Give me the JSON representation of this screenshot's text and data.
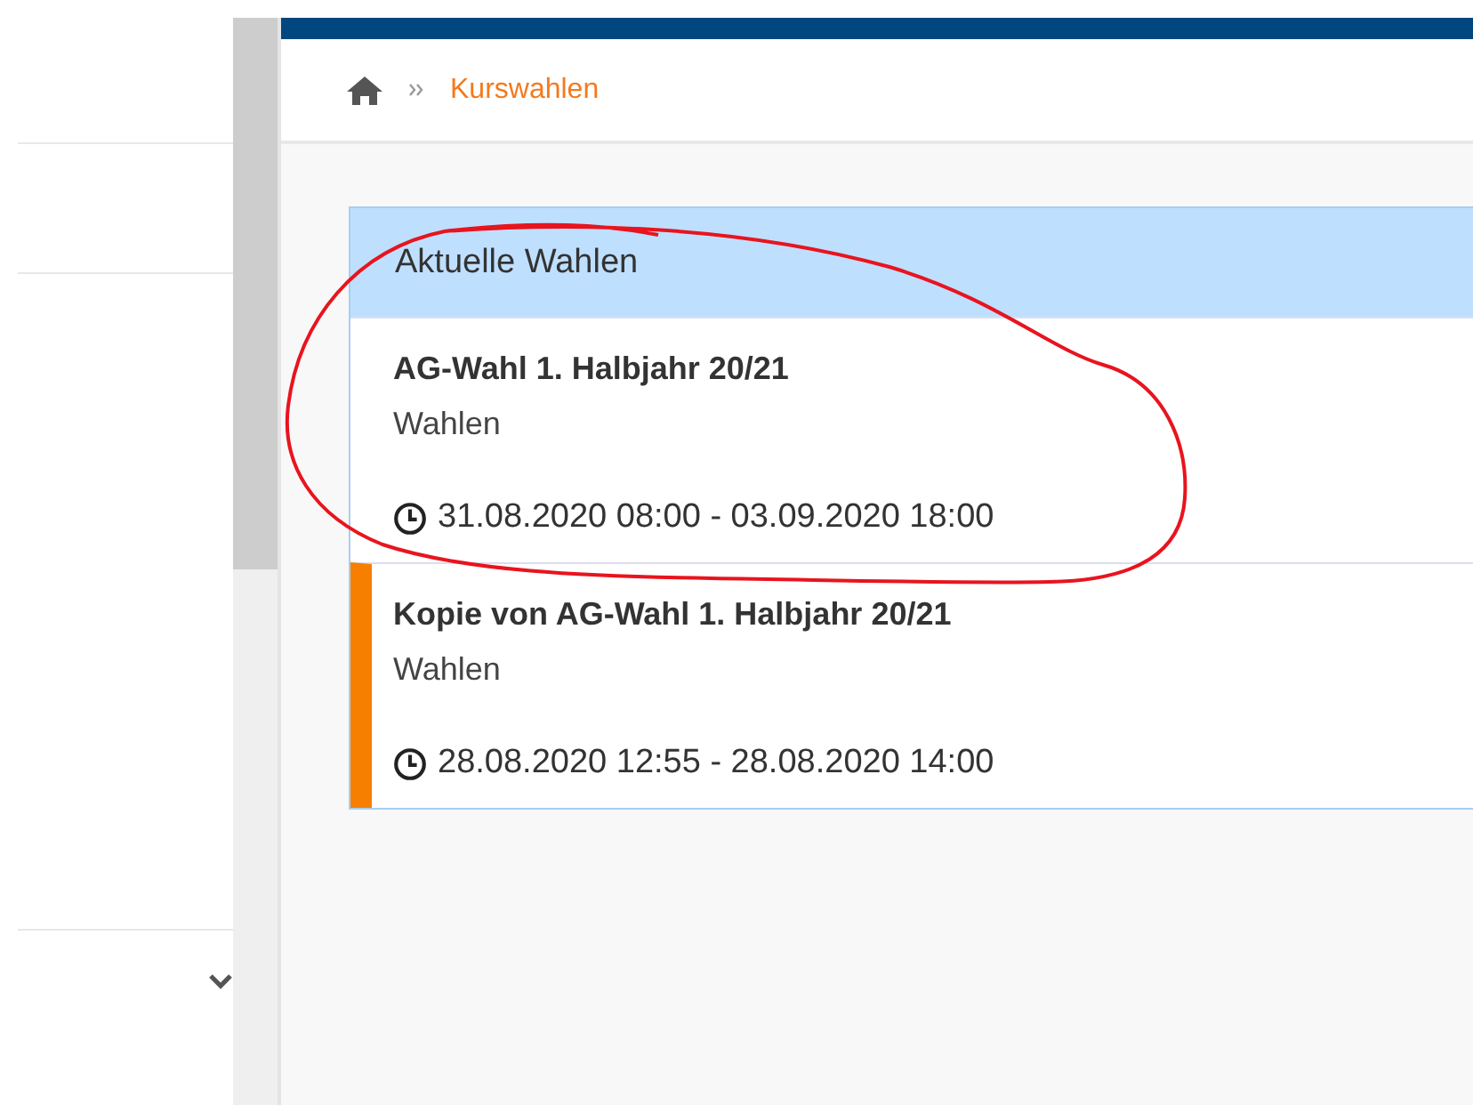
{
  "breadcrumb": {
    "current": "Kurswahlen"
  },
  "panel": {
    "title": "Aktuelle Wahlen",
    "items": [
      {
        "title": "AG-Wahl 1. Halbjahr 20/21",
        "subtitle": "Wahlen",
        "period": "31.08.2020 08:00 - 03.09.2020 18:00",
        "marked": false
      },
      {
        "title": "Kopie von AG-Wahl 1. Halbjahr 20/21",
        "subtitle": "Wahlen",
        "period": "28.08.2020 12:55 - 28.08.2020 14:00",
        "marked": true
      }
    ]
  },
  "annotation": {
    "kind": "freehand-circle"
  }
}
